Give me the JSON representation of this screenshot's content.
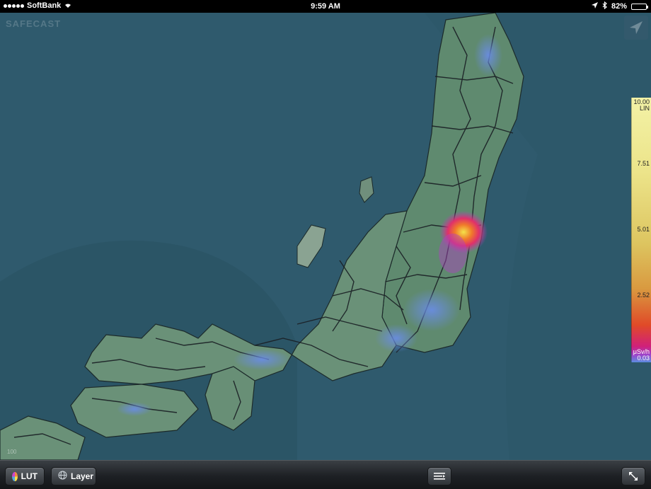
{
  "status_bar": {
    "carrier": "SoftBank",
    "time": "9:59 AM",
    "battery": "82%",
    "battery_level": 0.82
  },
  "map": {
    "watermark": "SAFECAST",
    "scale_label": "100"
  },
  "legend": {
    "max": "10.00",
    "scale": "LIN",
    "ticks": [
      "7.51",
      "5.01",
      "2.52"
    ],
    "unit": "μSv/h",
    "min": "0.03",
    "colors": [
      "#f3f2a6",
      "#ddc560",
      "#d99a40",
      "#e04a28",
      "#d0207a",
      "#a040c8",
      "#5c8ee0"
    ]
  },
  "toolbar": {
    "lut_label": "LUT",
    "layer_label": "Layer",
    "menu_icon": "list-icon",
    "expand_icon": "expand-icon"
  }
}
